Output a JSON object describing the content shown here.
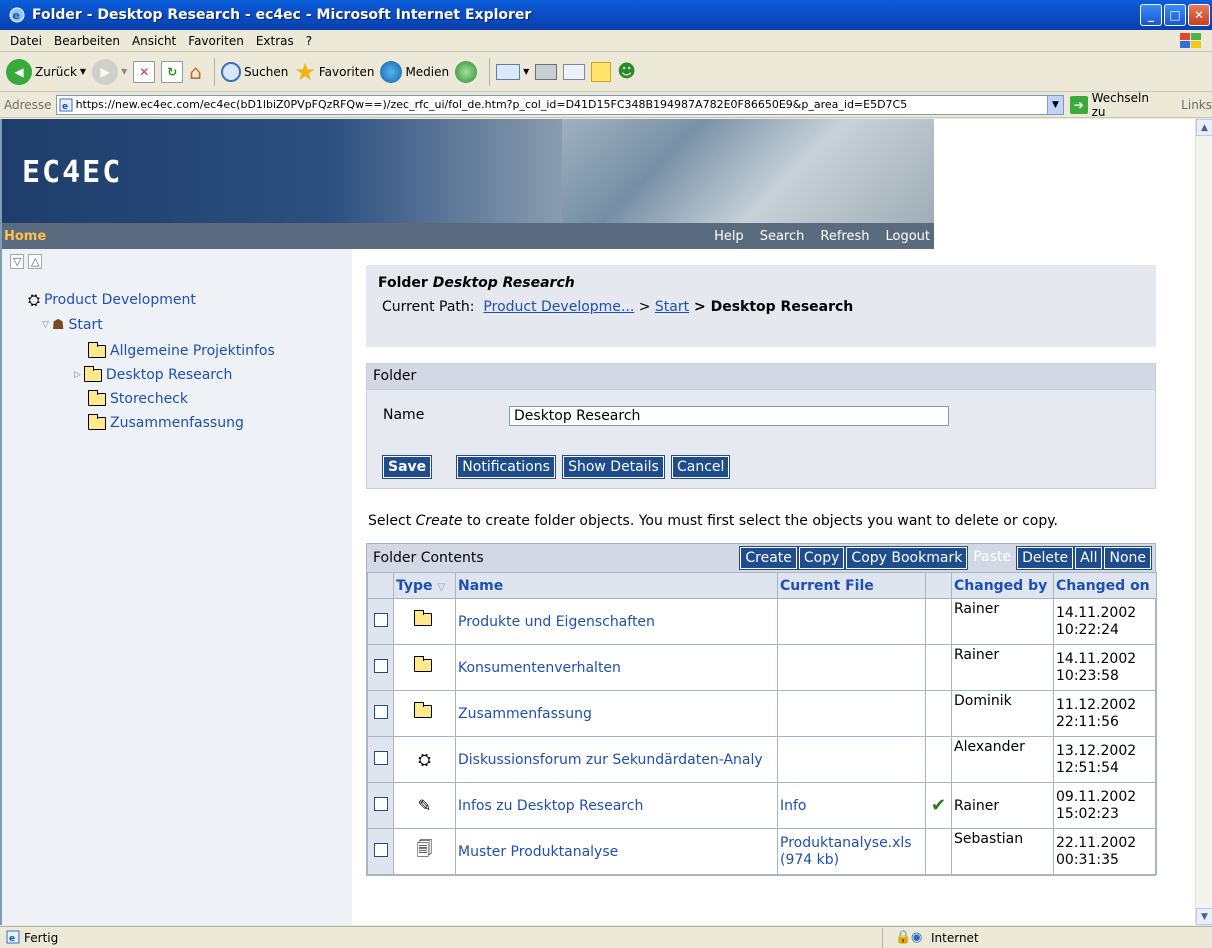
{
  "window": {
    "title": "Folder - Desktop Research - ec4ec - Microsoft Internet Explorer",
    "min_label": "_",
    "max_label": "□",
    "close_label": "✕"
  },
  "menu": [
    "Datei",
    "Bearbeiten",
    "Ansicht",
    "Favoriten",
    "Extras",
    "?"
  ],
  "toolbar": {
    "back": "Zurück",
    "search": "Suchen",
    "favorites": "Favoriten",
    "media": "Medien"
  },
  "address": {
    "label": "Adresse",
    "url": "https://new.ec4ec.com/ec4ec(bD1lbiZ0PVpFQzRFQw==)/zec_rfc_ui/fol_de.htm?p_col_id=D41D15FC348B194987A782E0F86650E9&p_area_id=E5D7C5",
    "go": "Wechseln zu",
    "links": "Links"
  },
  "site": {
    "logo": "EC4EC",
    "home": "Home",
    "nav": [
      "Help",
      "Search",
      "Refresh",
      "Logout"
    ]
  },
  "tree": {
    "root": "Product Development",
    "start": "Start",
    "children": [
      "Allgemeine Projektinfos",
      "Desktop Research",
      "Storecheck",
      "Zusammenfassung"
    ]
  },
  "folder_head": {
    "title_prefix": "Folder ",
    "title_name": "Desktop Research",
    "path_label": "Current Path:",
    "path_link1": "Product Developme...",
    "path_sep1": " > ",
    "path_link2": "Start",
    "path_current": " > Desktop Research"
  },
  "folder_form": {
    "header": "Folder",
    "name_label": "Name",
    "name_value": "Desktop Research",
    "buttons": {
      "save": "Save",
      "notifications": "Notifications",
      "show_details": "Show Details",
      "cancel": "Cancel"
    }
  },
  "hint": {
    "pre": "Select ",
    "em": "Create",
    "post": " to create folder objects. You must first select the objects you want to delete or copy."
  },
  "contents": {
    "title": "Folder Contents",
    "buttons": {
      "create": "Create",
      "copy": "Copy",
      "copy_bookmark": "Copy Bookmark",
      "paste": "Paste",
      "delete": "Delete",
      "all": "All",
      "none": "None"
    },
    "columns": {
      "type": "Type",
      "name": "Name",
      "current_file": "Current File",
      "changed_by": "Changed by",
      "changed_on": "Changed on"
    },
    "rows": [
      {
        "icon": "folder-icon",
        "name": "Produkte und Eigenschaften",
        "file": "",
        "file2": "",
        "check": "",
        "by": "Rainer",
        "date": "14.11.2002",
        "time": "10:22:24"
      },
      {
        "icon": "folder-icon",
        "name": "Konsumentenverhalten",
        "file": "",
        "file2": "",
        "check": "",
        "by": "Rainer",
        "date": "14.11.2002",
        "time": "10:23:58"
      },
      {
        "icon": "folder-icon",
        "name": "Zusammenfassung",
        "file": "",
        "file2": "",
        "check": "",
        "by": "Dominik",
        "date": "11.12.2002",
        "time": "22:11:56"
      },
      {
        "icon": "forum-icon",
        "name": "Diskussionsforum zur Sekundärdaten-Analy",
        "file": "",
        "file2": "",
        "check": "",
        "by": "Alexander",
        "date": "13.12.2002",
        "time": "12:51:54"
      },
      {
        "icon": "note-icon",
        "name": "Infos zu Desktop Research",
        "file": "Info",
        "file2": "",
        "check": "✔",
        "by": "Rainer",
        "date": "09.11.2002",
        "time": "15:02:23"
      },
      {
        "icon": "document-icon",
        "name": "Muster Produktanalyse",
        "file": "Produktanalyse.xls",
        "file2": "(974 kb)",
        "check": "",
        "by": "Sebastian",
        "date": "22.11.2002",
        "time": "00:31:35"
      }
    ]
  },
  "status": {
    "text": "Fertig",
    "zone": "Internet"
  }
}
